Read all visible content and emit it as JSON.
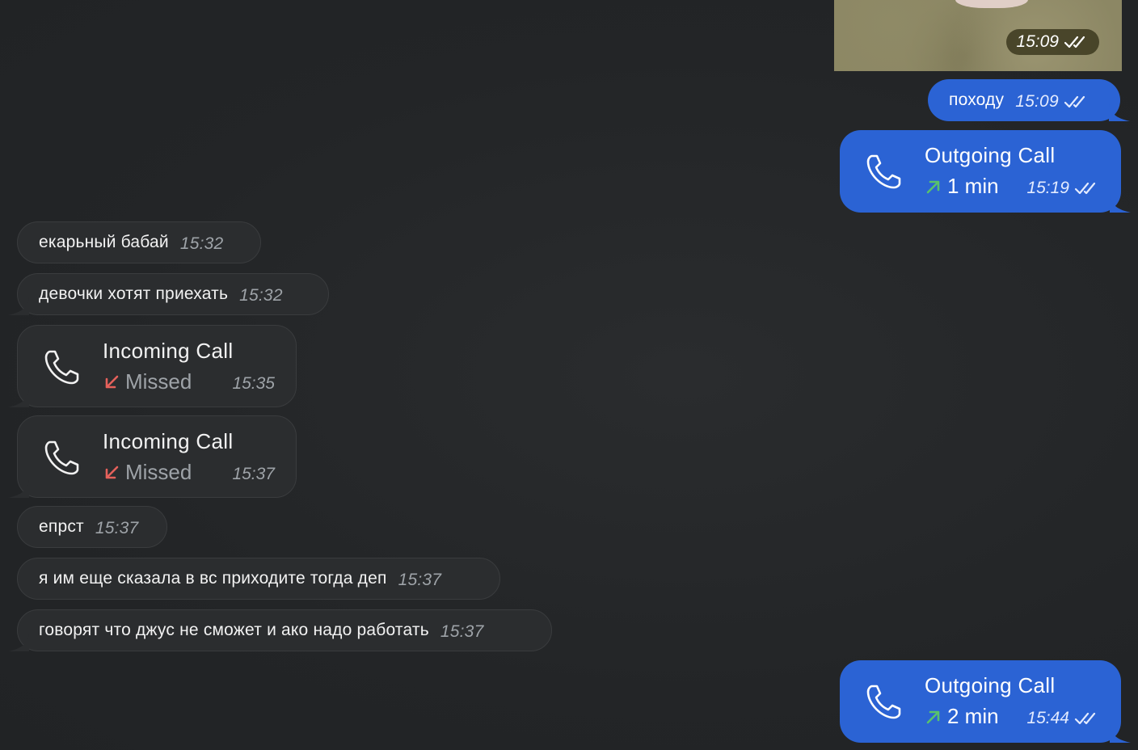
{
  "colors": {
    "background": "#242628",
    "incoming_bubble": "#2b2d2f",
    "outgoing_bubble": "#2b63d4",
    "missed_arrow": "#e5615b",
    "outgoing_arrow": "#58c26c",
    "time_incoming": "#9ea3a8"
  },
  "photo_message": {
    "time": "15:09",
    "status_icon": "double-check-icon"
  },
  "outgoing": [
    {
      "type": "text",
      "text": "походу",
      "time": "15:09",
      "status_icon": "double-check-icon"
    },
    {
      "type": "call",
      "title": "Outgoing Call",
      "detail": "1 min",
      "time": "15:19",
      "direction_icon": "arrow-up-right-icon",
      "status_icon": "double-check-icon"
    },
    {
      "type": "call",
      "title": "Outgoing Call",
      "detail": "2 min",
      "time": "15:44",
      "direction_icon": "arrow-up-right-icon",
      "status_icon": "double-check-icon"
    }
  ],
  "incoming": [
    {
      "type": "text",
      "text": "екарьный бабай",
      "time": "15:32"
    },
    {
      "type": "text",
      "text": "девочки хотят приехать",
      "time": "15:32"
    },
    {
      "type": "call",
      "title": "Incoming Call",
      "detail": "Missed",
      "time": "15:35",
      "direction_icon": "arrow-down-left-icon"
    },
    {
      "type": "call",
      "title": "Incoming Call",
      "detail": "Missed",
      "time": "15:37",
      "direction_icon": "arrow-down-left-icon"
    },
    {
      "type": "text",
      "text": "епрст",
      "time": "15:37"
    },
    {
      "type": "text",
      "text": "я им еще сказала в вс приходите тогда деп",
      "time": "15:37"
    },
    {
      "type": "text",
      "text": "говорят что джус не сможет и ако надо работать",
      "time": "15:37"
    }
  ]
}
